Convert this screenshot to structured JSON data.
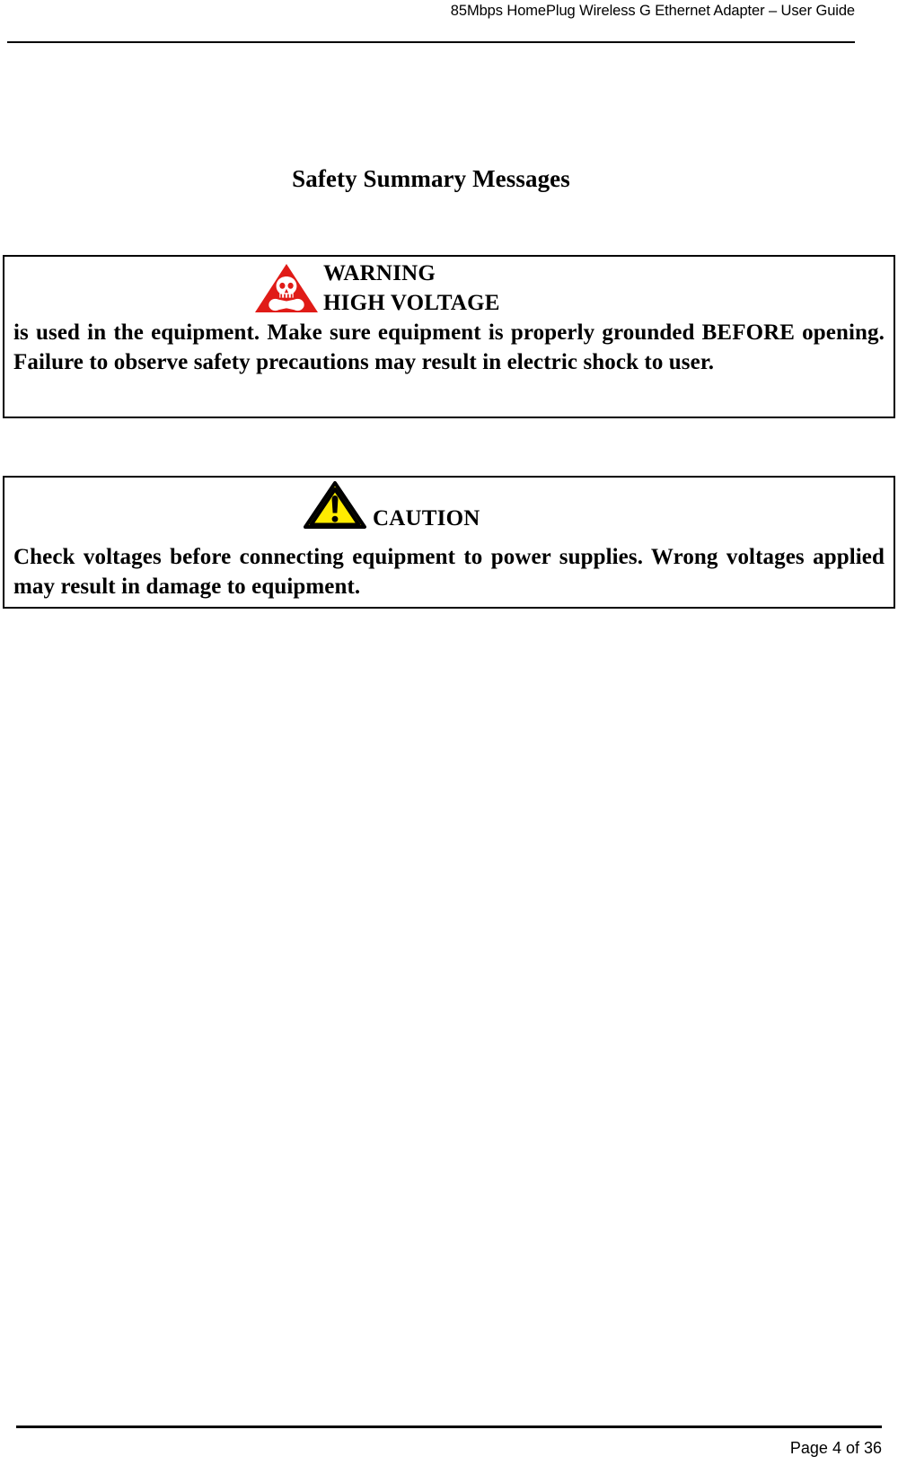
{
  "document": {
    "header_title": "85Mbps HomePlug Wireless G Ethernet Adapter – User Guide",
    "page_number_text": "Page 4 of 36"
  },
  "section": {
    "title": "Safety Summary Messages"
  },
  "alerts": [
    {
      "id": "warning",
      "icon_name": "high-voltage-skull-icon",
      "headline_line1": "WARNING",
      "headline_line2": "HIGH VOLTAGE",
      "body": "is used in the equipment. Make sure equipment is properly grounded BEFORE opening. Failure to observe safety precautions may result in electric shock to user.",
      "icon_colors": {
        "triangle_fill": "#e01b17",
        "skull_fill": "#ffffff"
      }
    },
    {
      "id": "caution",
      "icon_name": "caution-exclamation-icon",
      "headline_line1": "CAUTION",
      "body": "Check voltages before connecting equipment to power supplies. Wrong voltages applied may result in damage to equipment.",
      "icon_colors": {
        "triangle_fill": "#ffeb00",
        "triangle_stroke": "#000000",
        "mark_fill": "#000000"
      }
    }
  ],
  "colors": {
    "page_background": "#ffffff",
    "text": "#000000",
    "rule": "#000000"
  }
}
